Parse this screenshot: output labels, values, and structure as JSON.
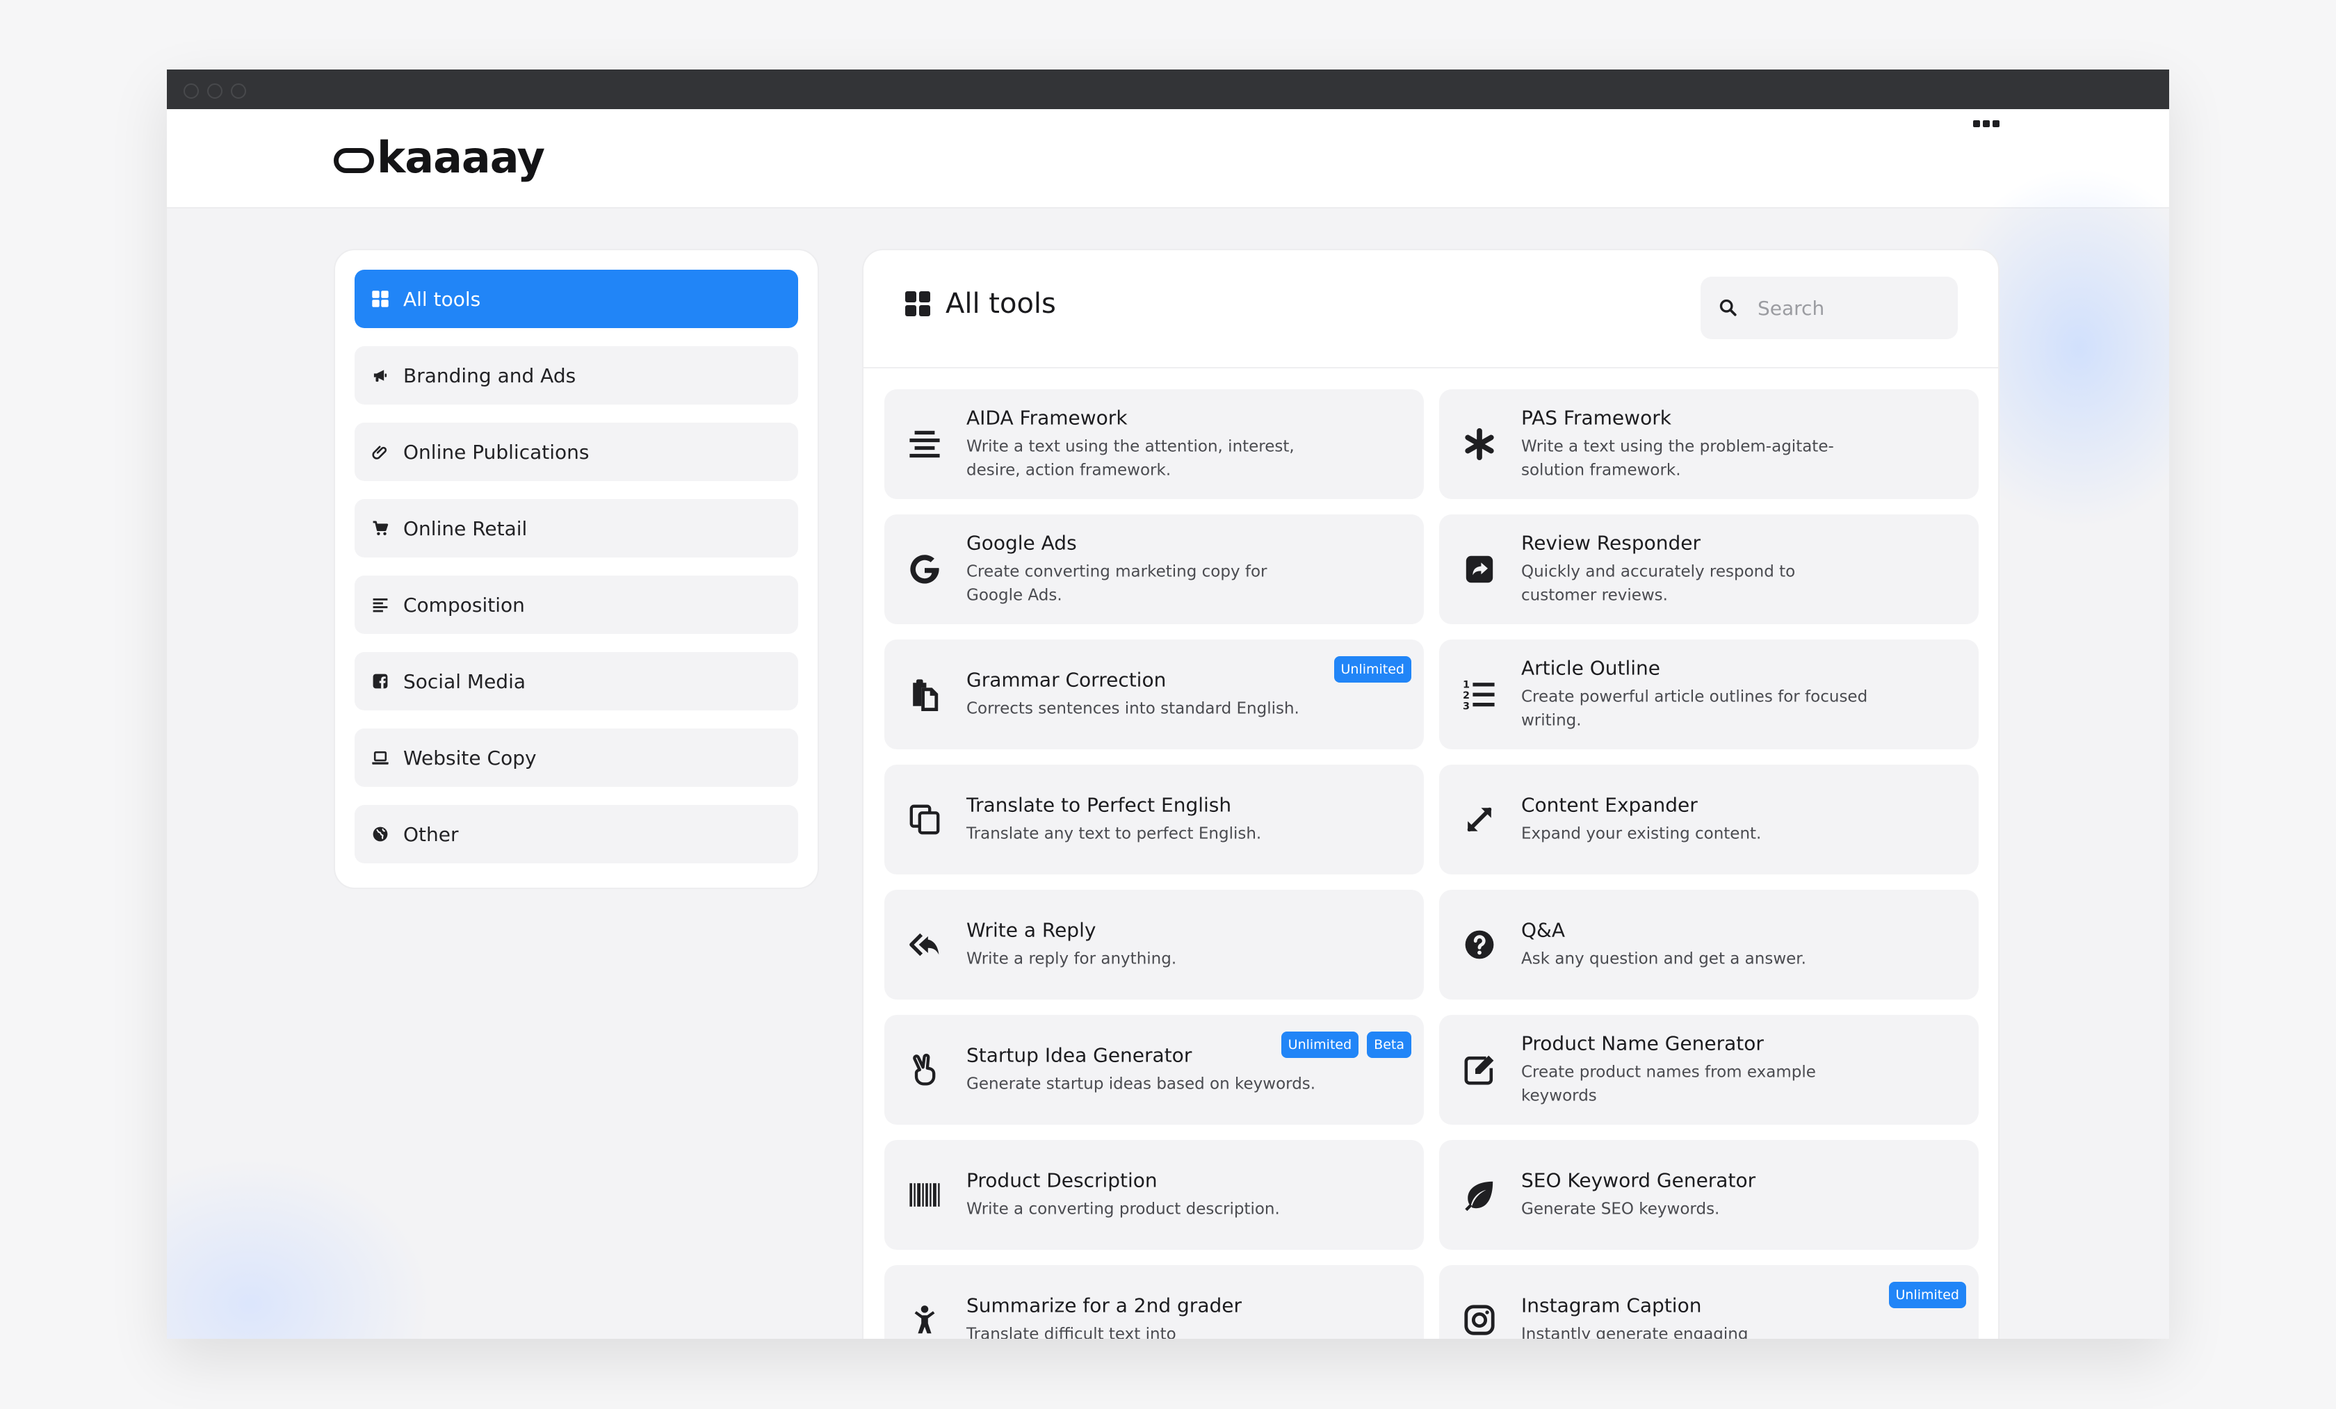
{
  "app": {
    "logo_text": "kaaaay"
  },
  "sidebar": {
    "items": [
      {
        "label": "All tools",
        "icon": "grid-icon",
        "active": true
      },
      {
        "label": "Branding and Ads",
        "icon": "megaphone-icon"
      },
      {
        "label": "Online Publications",
        "icon": "paperclip-icon"
      },
      {
        "label": "Online Retail",
        "icon": "cart-icon"
      },
      {
        "label": "Composition",
        "icon": "align-left-icon"
      },
      {
        "label": "Social Media",
        "icon": "facebook-icon"
      },
      {
        "label": "Website Copy",
        "icon": "laptop-icon"
      },
      {
        "label": "Other",
        "icon": "globe-icon"
      }
    ]
  },
  "main": {
    "title": "All tools",
    "search_placeholder": "Search"
  },
  "tools": [
    {
      "title": "AIDA Framework",
      "desc": "Write a text using the attention, interest, desire, action framework.",
      "icon": "align-center-icon",
      "badges": []
    },
    {
      "title": "PAS Framework",
      "desc": "Write a text using the problem-agitate-solution framework.",
      "icon": "asterisk-icon",
      "badges": []
    },
    {
      "title": "Google Ads",
      "desc": "Create converting marketing copy for Google Ads.",
      "icon": "google-icon",
      "badges": []
    },
    {
      "title": "Review Responder",
      "desc": "Quickly and accurately respond to customer reviews.",
      "icon": "share-square-icon",
      "badges": []
    },
    {
      "title": "Grammar Correction",
      "desc": "Corrects sentences into standard English.",
      "icon": "paste-icon",
      "badges": [
        "Unlimited"
      ]
    },
    {
      "title": "Article Outline",
      "desc": "Create powerful article outlines for focused writing.",
      "icon": "list-ol-icon",
      "badges": []
    },
    {
      "title": "Translate to Perfect English",
      "desc": "Translate any text to perfect English.",
      "icon": "copy-icon",
      "badges": []
    },
    {
      "title": "Content Expander",
      "desc": "Expand your existing content.",
      "icon": "expand-icon",
      "badges": []
    },
    {
      "title": "Write a Reply",
      "desc": "Write a reply for anything.",
      "icon": "reply-all-icon",
      "badges": []
    },
    {
      "title": "Q&A",
      "desc": "Ask any question and get a answer.",
      "icon": "question-circle-icon",
      "badges": []
    },
    {
      "title": "Startup Idea Generator",
      "desc": "Generate startup ideas based on keywords.",
      "icon": "hand-peace-icon",
      "badges": [
        "Unlimited",
        "Beta"
      ]
    },
    {
      "title": "Product Name Generator",
      "desc": "Create product names from example keywords",
      "icon": "edit-icon",
      "badges": []
    },
    {
      "title": "Product Description",
      "desc": "Write a converting product description.",
      "icon": "barcode-icon",
      "badges": []
    },
    {
      "title": "SEO Keyword Generator",
      "desc": "Generate SEO keywords.",
      "icon": "leaf-icon",
      "badges": []
    },
    {
      "title": "Summarize for a 2nd grader",
      "desc": "Translate difficult text into",
      "icon": "child-icon",
      "badges": []
    },
    {
      "title": "Instagram Caption",
      "desc": "Instantly generate engaging",
      "icon": "instagram-icon",
      "badges": [
        "Unlimited"
      ]
    }
  ]
}
